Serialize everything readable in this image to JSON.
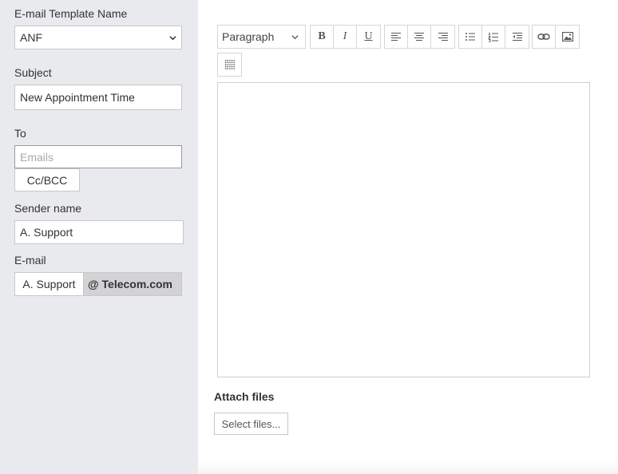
{
  "form": {
    "template_name_label": "E-mail Template Name",
    "template_name_value": "ANF",
    "subject_label": "Subject",
    "subject_value": "New Appointment Time",
    "to_label": "To",
    "to_placeholder": "Emails",
    "ccbcc_label": "Cc/BCC",
    "sender_name_label": "Sender name",
    "sender_name_value": "A. Support",
    "email_label": "E-mail",
    "email_local": "A. Support",
    "email_domain": "@ Telecom.com"
  },
  "toolbar": {
    "paragraph_label": "Paragraph",
    "bold_label": "B",
    "italic_label": "I",
    "underline_label": "U",
    "icons": [
      "chevron-down-icon",
      "align-left-icon",
      "align-center-icon",
      "align-right-icon",
      "bullet-list-icon",
      "numbered-list-icon",
      "outdent-icon",
      "link-icon",
      "image-icon",
      "table-icon"
    ]
  },
  "editor": {
    "content": ""
  },
  "attachments": {
    "title": "Attach files",
    "select_button_label": "Select files..."
  },
  "colors": {
    "sidebar_bg": "#e9eaee",
    "domain_addon_bg": "#d3d3d6",
    "border": "#c8c8c8"
  }
}
